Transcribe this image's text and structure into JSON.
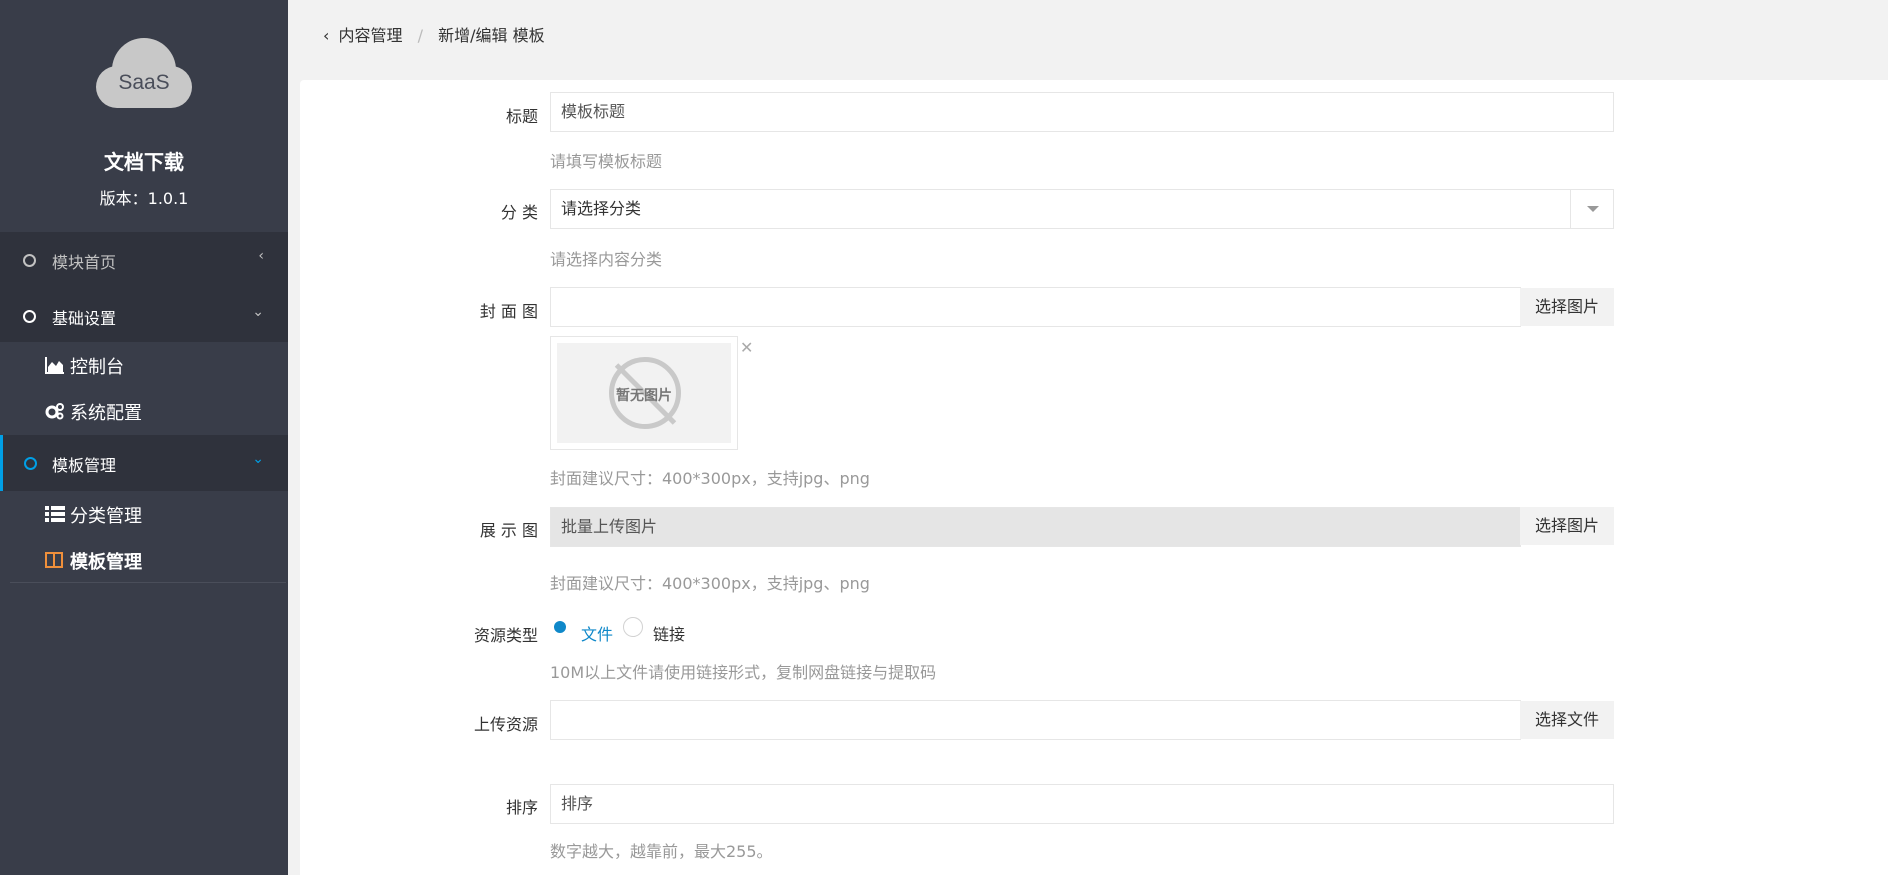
{
  "brand": {
    "logo_text": "SaaS",
    "title": "文档下载",
    "version": "版本：1.0.1"
  },
  "nav": {
    "module_home": "模块首页",
    "basic_settings": "基础设置",
    "console": "控制台",
    "system_config": "系统配置",
    "template_mgmt": "模板管理",
    "category_mgmt": "分类管理",
    "template_mgmt_child": "模板管理"
  },
  "breadcrumb": {
    "back": "‹",
    "parent": "内容管理",
    "separator": "/",
    "current": "新增/编辑 模板"
  },
  "form": {
    "title": {
      "label": "标题",
      "placeholder": "模板标题",
      "help": "请填写模板标题"
    },
    "category": {
      "label": "分 类",
      "selected": "请选择分类",
      "help": "请选择内容分类"
    },
    "cover": {
      "label": "封 面 图",
      "button": "选择图片",
      "no_image": "暂无图片",
      "remove": "✕",
      "help": "封面建议尺寸：400*300px，支持jpg、png"
    },
    "gallery": {
      "label": "展 示 图",
      "value": "批量上传图片",
      "button": "选择图片",
      "help": "封面建议尺寸：400*300px，支持jpg、png"
    },
    "resource_type": {
      "label": "资源类型",
      "option_file": "文件",
      "option_link": "链接",
      "help": "10M以上文件请使用链接形式，复制网盘链接与提取码"
    },
    "upload": {
      "label": "上传资源",
      "button": "选择文件"
    },
    "sort": {
      "label": "排序",
      "placeholder": "排序",
      "help": "数字越大，越靠前，最大255。"
    }
  },
  "colors": {
    "sidebar_bg": "#393d49",
    "sidebar_parent_bg": "#2f323c",
    "accent": "#009fe6",
    "radio_checked": "#0f88c9",
    "active_icon": "#f0903b"
  }
}
